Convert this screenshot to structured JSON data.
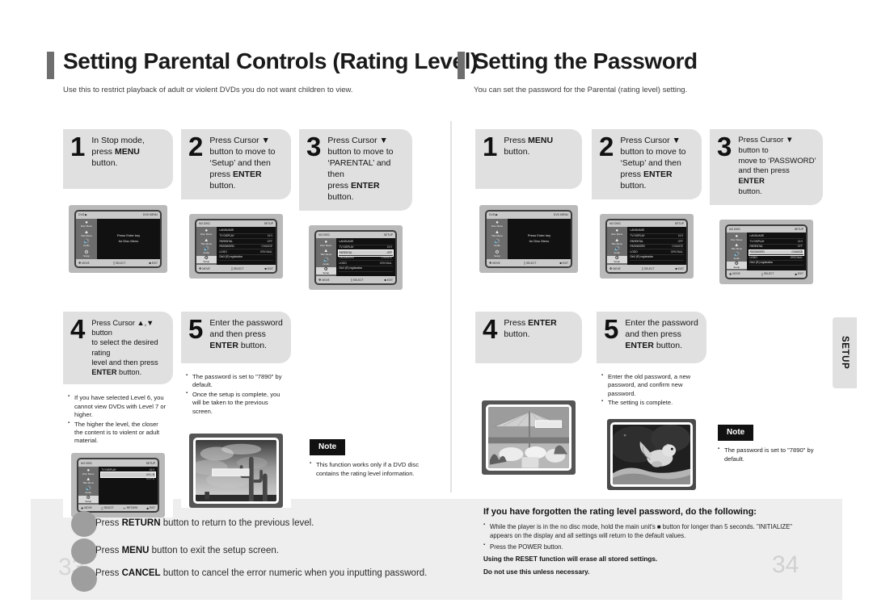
{
  "left_section": {
    "title": "Setting Parental Controls (Rating Level)",
    "subtitle": "Use this to restrict playback of adult or violent DVDs you do not want children to view.",
    "steps": [
      {
        "num": "1",
        "line1": "In Stop mode,",
        "line2_pre": "press ",
        "line2_bold": "MENU",
        "line3": "button."
      },
      {
        "num": "2",
        "line1": "Press Cursor ▼",
        "line2": "button to move to",
        "line3": "‘Setup’ and then",
        "line4_pre": "press ",
        "line4_bold": "ENTER",
        "line4_post": " button."
      },
      {
        "num": "3",
        "line1": "Press Cursor ▼",
        "line2": "button to move to",
        "line3": "‘PARENTAL’ and then",
        "line4_pre": "press ",
        "line4_bold": "ENTER",
        "line4_post": " button."
      },
      {
        "num": "4",
        "line1": "Press Cursor ▲,▼ button",
        "line2": "to select the desired rating",
        "line3": "level and then press",
        "line4_bold": "ENTER",
        "line4_post": " button."
      },
      {
        "num": "5",
        "line1": "Enter the password",
        "line2": "and then press",
        "line3_bold": "ENTER",
        "line3_post": " button."
      }
    ],
    "bullets_step4": [
      "If you have selected Level 6, you cannot view DVDs with Level 7 or higher.",
      "The higher the level, the closer the content is to violent or adult material."
    ],
    "bullets_step5": [
      "The password is set to \"7890\" by default.",
      "Once the setup is complete, you will be taken to the previous screen."
    ],
    "note": {
      "label": "Note",
      "text": "This function works only if a DVD disc contains the rating level information."
    },
    "screens": {
      "s1": {
        "header_left": "DVD ▶",
        "header_right": "DVD MENU",
        "center_line1": "Press Enter key",
        "center_line2": "for Disc Menu",
        "side": [
          "Disc Menu",
          "Title Menu",
          "Audio",
          "Setup"
        ],
        "bottom": [
          "MOVE",
          "SELECT",
          "EXIT"
        ]
      },
      "s2": {
        "header_left": "NO DISC",
        "header_right": "SETUP",
        "side": [
          "Disc Menu",
          "Title Menu",
          "Audio",
          "Setup"
        ],
        "rows": [
          {
            "label": "LANGUAGE",
            "value": ""
          },
          {
            "label": "TV DISPLAY",
            "value": "16:9"
          },
          {
            "label": "PARENTAL",
            "value": "OFF"
          },
          {
            "label": "PASSWORD",
            "value": "CHANGE"
          },
          {
            "label": "LOGO",
            "value": "ORIGINAL"
          },
          {
            "label": "DivX (R) registration",
            "value": ""
          }
        ],
        "highlight_index": -1,
        "bottom": [
          "MOVE",
          "SELECT",
          "EXIT"
        ]
      },
      "s3": {
        "header_left": "NO DISC",
        "header_right": "SETUP",
        "side": [
          "Disc Menu",
          "Title Menu",
          "Audio",
          "Setup"
        ],
        "rows": [
          {
            "label": "LANGUAGE",
            "value": ""
          },
          {
            "label": "TV DISPLAY",
            "value": "16:9"
          },
          {
            "label": "PARENTAL",
            "value": "OFF"
          },
          {
            "label": "PASSWORD",
            "value": "CHANGE"
          },
          {
            "label": "LOGO",
            "value": "ORIGINAL"
          },
          {
            "label": "DivX (R) registration",
            "value": ""
          }
        ],
        "highlight_index": 2,
        "bottom": [
          "MOVE",
          "SELECT",
          "EXIT"
        ]
      },
      "s4": {
        "header_left": "NO DISC",
        "header_right": "SETUP",
        "side": [
          "Disc Menu",
          "Title Menu",
          "Audio",
          "Setup"
        ],
        "rows": [
          {
            "label": "TV DISPLAY",
            "value": "16:9"
          },
          {
            "label": "",
            "value": "4:3 L.B"
          },
          {
            "label": "",
            "value": "4:3 P.S"
          }
        ],
        "highlight_index": 1,
        "bottom": [
          "MOVE",
          "SELECT",
          "RETURN",
          "EXIT"
        ]
      },
      "s5": {
        "type": "photo",
        "caption": "password entry overlay"
      }
    }
  },
  "right_section": {
    "title": "Setting the Password",
    "subtitle": "You can set the password for the Parental (rating level) setting.",
    "steps": [
      {
        "num": "1",
        "line1_pre": "Press ",
        "line1_bold": "MENU",
        "line2": "button."
      },
      {
        "num": "2",
        "line1": "Press Cursor ▼",
        "line2": "button to move to",
        "line3": "‘Setup’ and then",
        "line4_pre": "press ",
        "line4_bold": "ENTER",
        "line4_post": " button."
      },
      {
        "num": "3",
        "line1": "Press Cursor ▼ button to",
        "line2": "move to ‘PASSWORD’",
        "line3_pre": "and then press ",
        "line3_bold": "ENTER",
        "line4": "button."
      },
      {
        "num": "4",
        "line1_pre": "Press ",
        "line1_bold": "ENTER",
        "line2": "button."
      },
      {
        "num": "5",
        "line1": "Enter the password",
        "line2": "and then press",
        "line3_bold": "ENTER",
        "line3_post": " button."
      }
    ],
    "bullets_step5": [
      "Enter the old password, a new password, and confirm new password.",
      "The setting is complete."
    ],
    "note": {
      "label": "Note",
      "text": "The password is set to \"7890\" by default."
    },
    "screens": {
      "s1": {
        "header_left": "DVD ▶",
        "header_right": "DVD MENU",
        "center_line1": "Press Enter key",
        "center_line2": "for Disc Menu",
        "side": [
          "Disc Menu",
          "Title Menu",
          "Audio",
          "Setup"
        ],
        "bottom": [
          "MOVE",
          "SELECT",
          "EXIT"
        ]
      },
      "s2": {
        "header_left": "NO DISC",
        "header_right": "SETUP",
        "side": [
          "Disc Menu",
          "Title Menu",
          "Audio",
          "Setup"
        ],
        "rows": [
          {
            "label": "LANGUAGE",
            "value": ""
          },
          {
            "label": "TV DISPLAY",
            "value": "16:9"
          },
          {
            "label": "PARENTAL",
            "value": "OFF"
          },
          {
            "label": "PASSWORD",
            "value": "CHANGE"
          },
          {
            "label": "LOGO",
            "value": "ORIGINAL"
          },
          {
            "label": "DivX (R) registration",
            "value": ""
          }
        ],
        "highlight_index": -1,
        "bottom": [
          "MOVE",
          "SELECT",
          "EXIT"
        ]
      },
      "s3": {
        "header_left": "NO DISC",
        "header_right": "SETUP",
        "side": [
          "Disc Menu",
          "Title Menu",
          "Audio",
          "Setup"
        ],
        "rows": [
          {
            "label": "LANGUAGE",
            "value": ""
          },
          {
            "label": "TV DISPLAY",
            "value": "16:9"
          },
          {
            "label": "PARENTAL",
            "value": "OFF"
          },
          {
            "label": "PASSWORD",
            "value": "CHANGE"
          },
          {
            "label": "LOGO",
            "value": "ORIGINAL"
          },
          {
            "label": "DivX (R) registration",
            "value": ""
          }
        ],
        "highlight_index": 3,
        "bottom": [
          "MOVE",
          "SELECT",
          "EXIT"
        ]
      }
    }
  },
  "setup_tab": "SETUP",
  "footer_left": {
    "rows": [
      {
        "pre": "Press ",
        "bold": "RETURN",
        "post": " button to return to the previous level."
      },
      {
        "pre": "Press ",
        "bold": "MENU",
        "post": " button to exit the setup screen."
      },
      {
        "pre": "Press ",
        "bold": "CANCEL",
        "post": " button to cancel the error numeric when you inputting password."
      }
    ],
    "page_number": "33"
  },
  "footer_right": {
    "title": "If you have forgotten the rating level password, do the following:",
    "bullets": [
      "While the player is in the no disc mode, hold the main unit's ■ button for longer than 5 seconds. \"INITIALIZE\" appears on the display and all settings will return to the default values.",
      "Press the POWER button."
    ],
    "strong_line1": "Using the RESET function will erase all stored settings.",
    "strong_line2": "Do not use this unless necessary.",
    "page_number": "34"
  }
}
